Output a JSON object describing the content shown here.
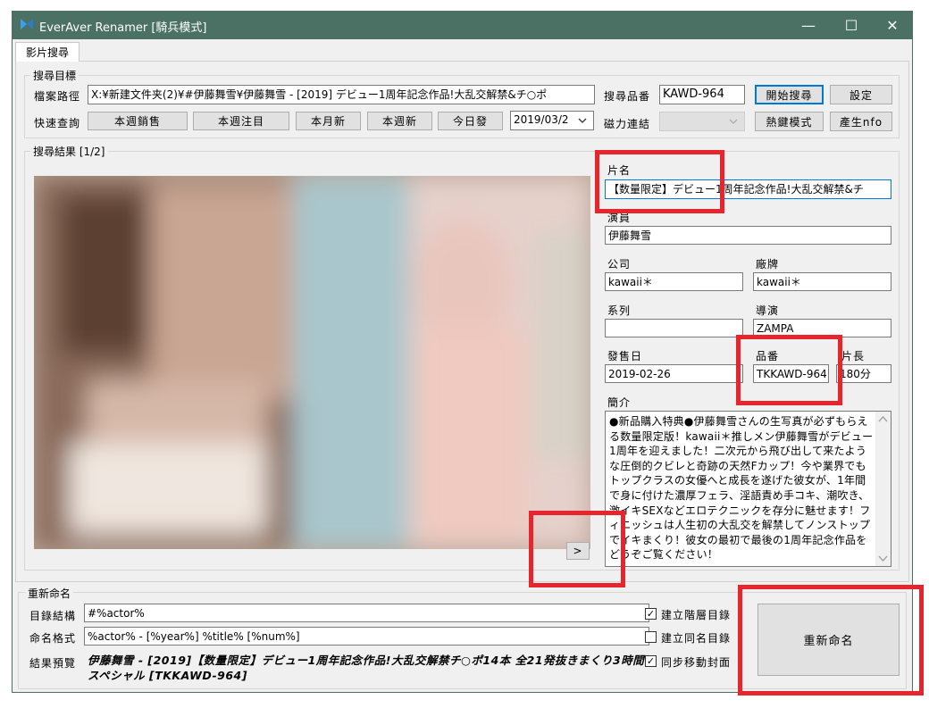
{
  "window": {
    "title": "EverAver Renamer [騎兵模式]",
    "controls": {
      "minimize": "—",
      "maximize": "☐",
      "close": "✕"
    },
    "colors": {
      "titlebar": "#4a7163",
      "accent": "#0078d7",
      "highlight": "#e8242c"
    }
  },
  "tabs": [
    {
      "label": "影片搜尋"
    }
  ],
  "search_target": {
    "group_label": "搜尋目標",
    "path_label": "檔案路徑",
    "path_value": "X:¥新建文件夹(2)¥#伊藤舞雪¥伊藤舞雪 - [2019] デビュー1周年記念作品!大乱交解禁&チ○ポ",
    "quick_label": "快速查詢",
    "quick_buttons": [
      "本週銷售",
      "本週注目",
      "本月新",
      "本週新",
      "今日發"
    ],
    "date_value": "2019/03/2",
    "product_label": "搜尋品番",
    "product_value": "KAWD-964",
    "magnet_label": "磁力連結",
    "start_button": "開始搜尋",
    "settings_button": "設定",
    "hotkey_button": "熱鍵模式",
    "nfo_button": "產生nfo"
  },
  "results": {
    "group_label": "搜尋結果 [1/2]",
    "next_button": ">",
    "fields": {
      "title_label": "片名",
      "title_value": "【数量限定】デビュー1周年記念作品!大乱交解禁&チ",
      "actor_label": "演員",
      "actor_value": "伊藤舞雪",
      "company_label": "公司",
      "company_value": "kawaii＊",
      "label_label": "廠牌",
      "label_value": "kawaii＊",
      "series_label": "系列",
      "series_value": "",
      "director_label": "導演",
      "director_value": "ZAMPA",
      "release_label": "發售日",
      "release_value": "2019-02-26",
      "number_label": "品番",
      "number_value": "TKKAWD-964",
      "length_label": "片長",
      "length_value": "180分",
      "summary_label": "簡介",
      "summary_value": "●新品購入特典●伊藤舞雪さんの生写真が必ずもらえる数量限定版！kawaii＊推しメン伊藤舞雪がデビュー1周年を迎えました！二次元から飛び出して来たような圧倒的クビレと奇跡の天然Fカップ！今や業界でもトップクラスの女優へと成長を遂げた彼女が、1年間で身に付けた濃厚フェラ、淫語責め手コキ、潮吹き、激イキSEXなどエロテクニックを存分に魅せます！フィニッシュは人生初の大乱交を解禁してノンストップでイキまくり！彼女の最初で最後の1周年記念作品をどうぞご覧ください！"
    }
  },
  "rename": {
    "group_label": "重新命名",
    "dir_label": "目錄結構",
    "dir_value": "#%actor%",
    "format_label": "命名格式",
    "format_value": "%actor% - [%year%] %title% [%num%]",
    "preview_label": "結果預覽",
    "preview_value": "伊藤舞雪 - [2019]【数量限定】デビュー1周年記念作品!大乱交解禁チ○ポ14本 全21発抜きまくり3時間スペシャル [TKKAWD-964]",
    "opt_hierarchy": "建立階層目錄",
    "opt_hierarchy_checked": true,
    "opt_same_name": "建立同名目錄",
    "opt_same_name_checked": false,
    "opt_sync_cover": "同步移動封面",
    "opt_sync_cover_checked": true,
    "rename_button": "重新命名"
  }
}
